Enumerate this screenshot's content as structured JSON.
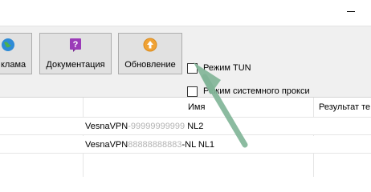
{
  "toolbar": {
    "ads_label": "клама",
    "docs_label": "Документация",
    "update_label": "Обновление"
  },
  "options": {
    "tun_label": "Режим TUN",
    "proxy_label": "Режим системного прокси",
    "tun_checked": false,
    "proxy_checked": false
  },
  "table": {
    "columns": [
      "Имя",
      "Результат те"
    ],
    "rows": [
      {
        "prefix": "VesnaVPN",
        "masked": "-99999999999",
        "suffix": " NL2"
      },
      {
        "prefix": "VesnaVPN",
        "masked": "88888888883",
        "suffix": "-NL NL1"
      }
    ]
  },
  "colors": {
    "arrow": "#7fb496",
    "toolbar_bg": "#f0f0f0",
    "button_bg": "#e1e1e1",
    "docs_icon": "#9b3bb8",
    "update_icon": "#f0a234"
  },
  "icons": {
    "ads": "globe-icon",
    "docs": "help-book-icon",
    "update": "upload-arrow-icon",
    "window": "minimize-icon"
  }
}
